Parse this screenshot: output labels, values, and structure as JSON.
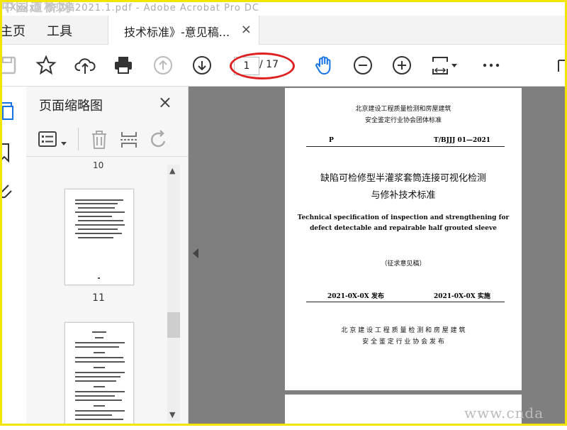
{
  "titlebar": {
    "text": "《Xxxx》意见稿2021.1.pdf - Adobe Acrobat Pro DC",
    "watermark": "中国道桥网"
  },
  "menu": {
    "home": "主页",
    "tools": "工具"
  },
  "doc_tab": {
    "label": "技术标准》-意见稿...",
    "close": "×"
  },
  "toolbar": {
    "page_current": "1",
    "page_total": "/ 17"
  },
  "panel": {
    "title": "页面缩略图",
    "close": "×",
    "partial_num": "10",
    "thumb_11_label": "11"
  },
  "document": {
    "header_line1": "北京建设工程质量检测和房屋建筑",
    "header_line2": "安全鉴定行业协会团体标准",
    "code_left": "P",
    "code_right": "T/BJJJ 01—2021",
    "title_cn_1": "缺陷可检修型半灌浆套筒连接可视化检测",
    "title_cn_2": "与修补技术标准",
    "title_en_1": "Technical specification of inspection and strengthening for",
    "title_en_2": "defect detectable and repairable half grouted sleeve",
    "draft": "（征求意见稿）",
    "issue_date": "2021-0X-0X   发布",
    "impl_date": "2021-0X-0X   实施",
    "publisher_1": "北 京 建 设 工 程 质 量 检 测 和 房 屋 建 筑",
    "publisher_2": "安 全 鉴 定 行 业 协 会      发 布"
  },
  "watermark_bottom": "www.cnda",
  "colors": {
    "highlight_ring": "#e02020",
    "frame": "#f2e600",
    "hand_tool": "#1473e6"
  }
}
